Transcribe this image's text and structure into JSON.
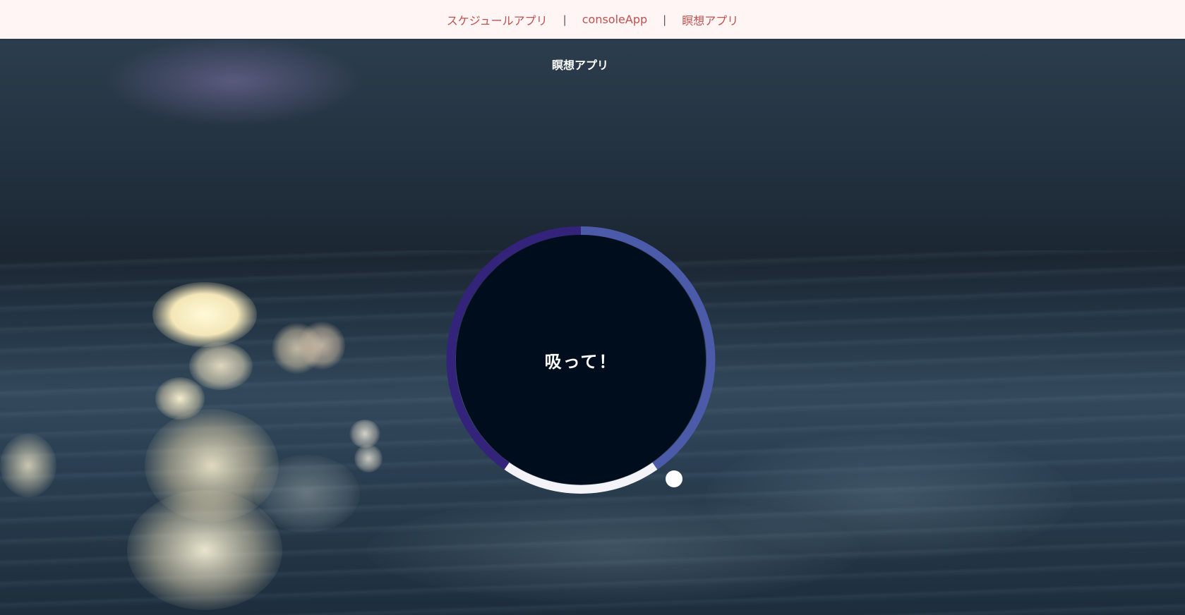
{
  "nav": {
    "items": [
      {
        "label": "スケジュールアプリ"
      },
      {
        "label": "consoleApp"
      },
      {
        "label": "瞑想アプリ"
      }
    ],
    "separator": "|"
  },
  "page": {
    "title": "瞑想アプリ"
  },
  "breath": {
    "instruction": "吸って！",
    "progress": 0.36,
    "colors": {
      "circle_fill": "#000d1c",
      "inhale_arc": "#4c5aaa",
      "hold_arc": "#f4f4f8",
      "exhale_arc": "#33237a",
      "pointer": "#ffffff"
    }
  },
  "colors": {
    "nav_background": "#fff5f5",
    "nav_link": "#c0504d"
  },
  "icons": {
    "progress_pointer": "pointer-dot-icon"
  }
}
